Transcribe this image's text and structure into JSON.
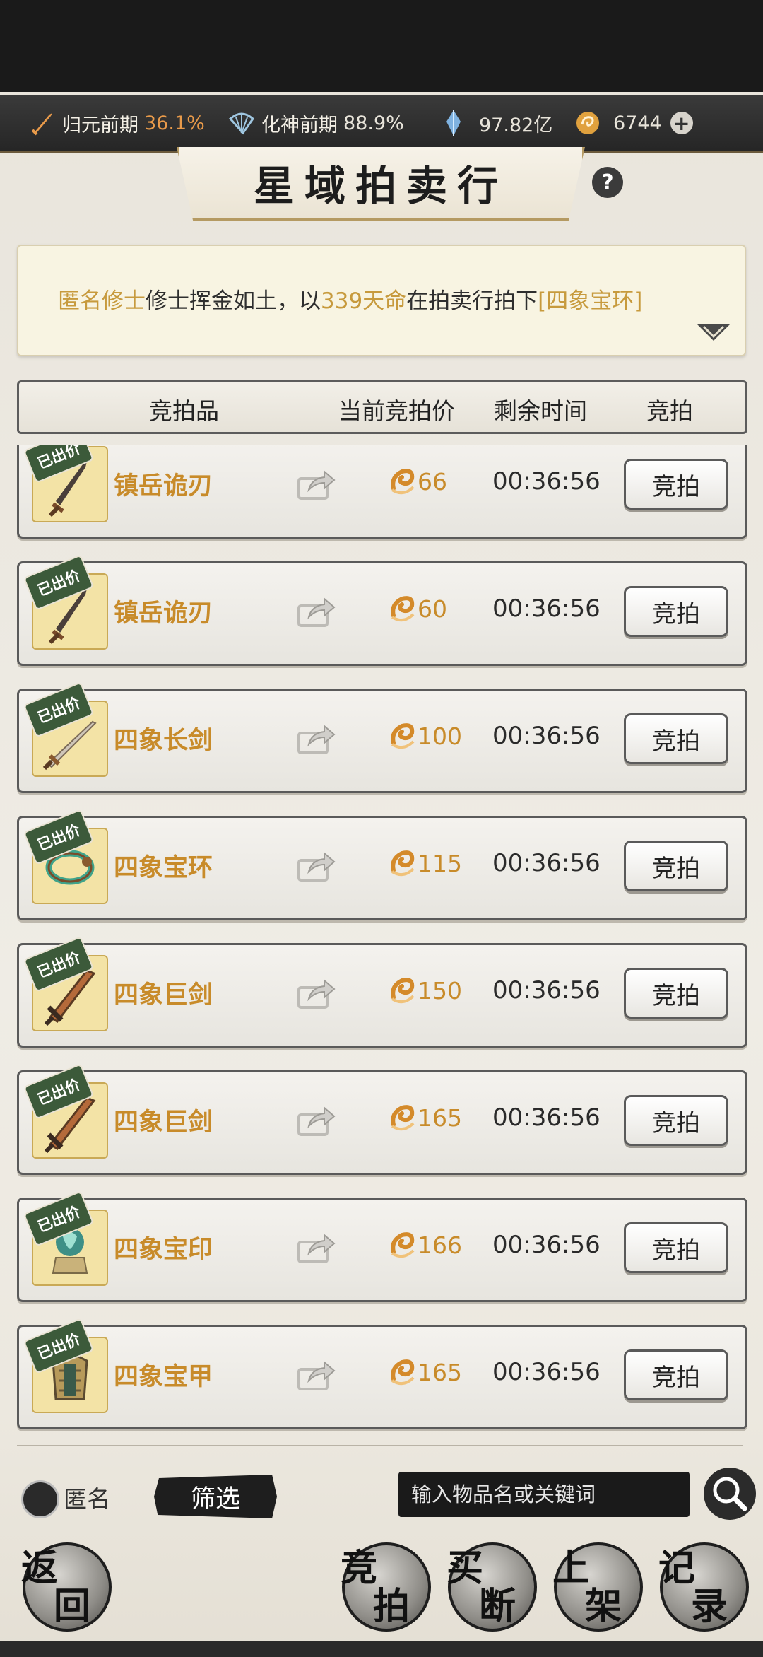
{
  "status_bar": {
    "stat1": {
      "label": "归元前期",
      "value": "36.1%"
    },
    "stat2": {
      "label": "化神前期",
      "value": "88.9%"
    },
    "stat3": {
      "value": "97.82亿"
    },
    "stat4": {
      "value": "6744"
    }
  },
  "title": "星域拍卖行",
  "help_label": "?",
  "notice": {
    "name": "匿名修士",
    "text1": "修士挥金如土，以",
    "amount": "339天命",
    "text2": "在拍卖行拍下",
    "item": "[四象宝环]"
  },
  "table_header": {
    "item": "竞拍品",
    "price": "当前竞拍价",
    "time": "剩余时间",
    "action": "竞拍"
  },
  "badge_label": "已出价",
  "bid_label": "竞拍",
  "rows": [
    {
      "name": "镇岳诡刃",
      "price": "66",
      "time": "00:36:56",
      "icon": "blade-icon"
    },
    {
      "name": "镇岳诡刃",
      "price": "60",
      "time": "00:36:56",
      "icon": "blade-icon"
    },
    {
      "name": "四象长剑",
      "price": "100",
      "time": "00:36:56",
      "icon": "longsword-icon"
    },
    {
      "name": "四象宝环",
      "price": "115",
      "time": "00:36:56",
      "icon": "ring-icon"
    },
    {
      "name": "四象巨剑",
      "price": "150",
      "time": "00:36:56",
      "icon": "greatsword-icon"
    },
    {
      "name": "四象巨剑",
      "price": "165",
      "time": "00:36:56",
      "icon": "greatsword-icon"
    },
    {
      "name": "四象宝印",
      "price": "166",
      "time": "00:36:56",
      "icon": "seal-icon"
    },
    {
      "name": "四象宝甲",
      "price": "165",
      "time": "00:36:56",
      "icon": "armor-icon"
    }
  ],
  "bottom": {
    "anonymous_label": "匿名",
    "filter_label": "筛选",
    "search_placeholder": "输入物品名或关键词"
  },
  "nav": {
    "back": [
      "返",
      "回"
    ],
    "bid": [
      "竞",
      "拍"
    ],
    "buyout": [
      "买",
      "断"
    ],
    "list": [
      "上",
      "架"
    ],
    "record": [
      "记",
      "录"
    ]
  }
}
